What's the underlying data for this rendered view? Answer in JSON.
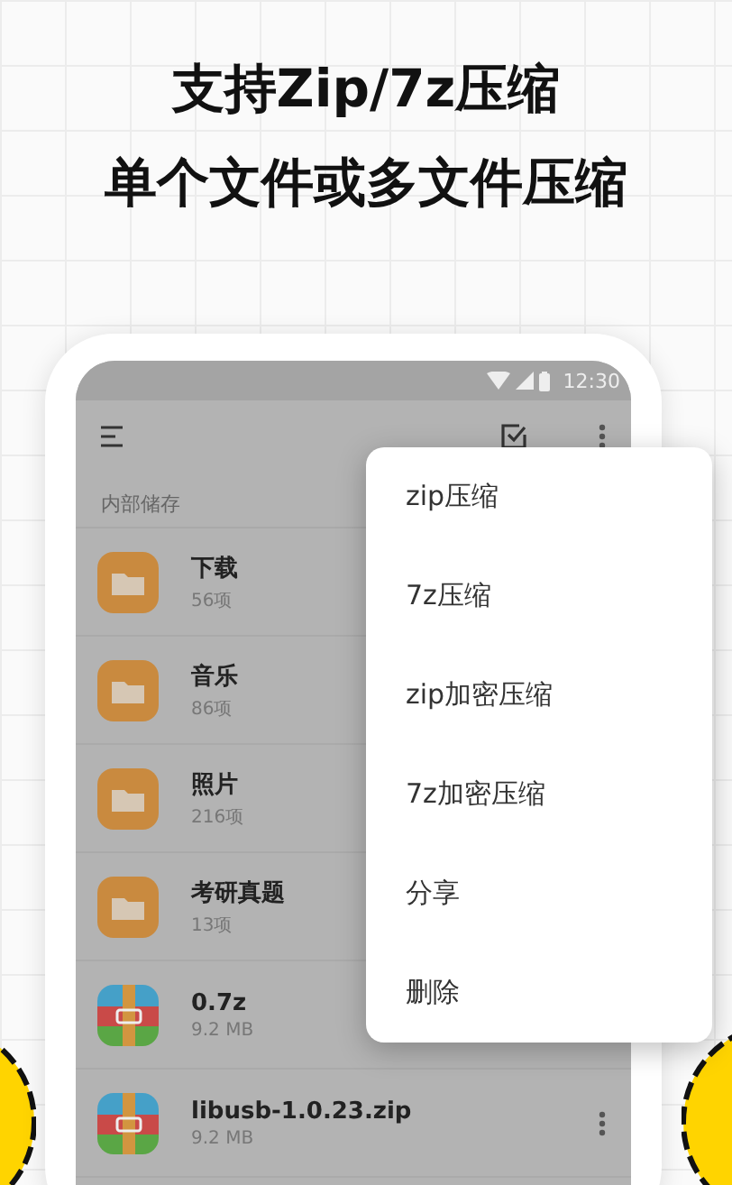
{
  "headline": [
    "支持Zip/7z压缩",
    "单个文件或多文件压缩"
  ],
  "status_bar": {
    "time": "12:30"
  },
  "section_label": "内部储存",
  "files": [
    {
      "kind": "folder",
      "name": "下载",
      "detail": "56项"
    },
    {
      "kind": "folder",
      "name": "音乐",
      "detail": "86项"
    },
    {
      "kind": "folder",
      "name": "照片",
      "detail": "216项"
    },
    {
      "kind": "folder",
      "name": "考研真题",
      "detail": "13项"
    },
    {
      "kind": "archive",
      "name": "0.7z",
      "detail": "9.2 MB"
    },
    {
      "kind": "archive",
      "name": "libusb-1.0.23.zip",
      "detail": "9.2 MB"
    }
  ],
  "popup_menu": [
    "zip压缩",
    "7z压缩",
    "zip加密压缩",
    "7z加密压缩",
    "分享",
    "删除"
  ]
}
